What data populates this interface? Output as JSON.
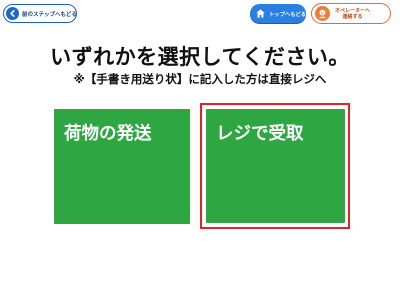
{
  "header": {
    "back_label": "前のステップへもどる",
    "top_label": "トップへもどる",
    "operator_label": "オペレーターへ\n連絡する"
  },
  "main": {
    "title": "いずれかを選択してください。",
    "note": "※【手書き用送り状】に記入した方は直接レジへ",
    "options": [
      {
        "label": "荷物の発送"
      },
      {
        "label": "レジで受取"
      }
    ],
    "highlighted_option": "レジで受取"
  },
  "colors": {
    "option_green": "#2ea642",
    "highlight_red": "#e0232a",
    "back_blue": "#1f5fc4",
    "top_blue": "#2a7fe0",
    "operator_orange": "#e9682d"
  },
  "icons": {
    "back": "back-arrow-icon",
    "top": "home-icon",
    "operator": "operator-face-icon"
  }
}
